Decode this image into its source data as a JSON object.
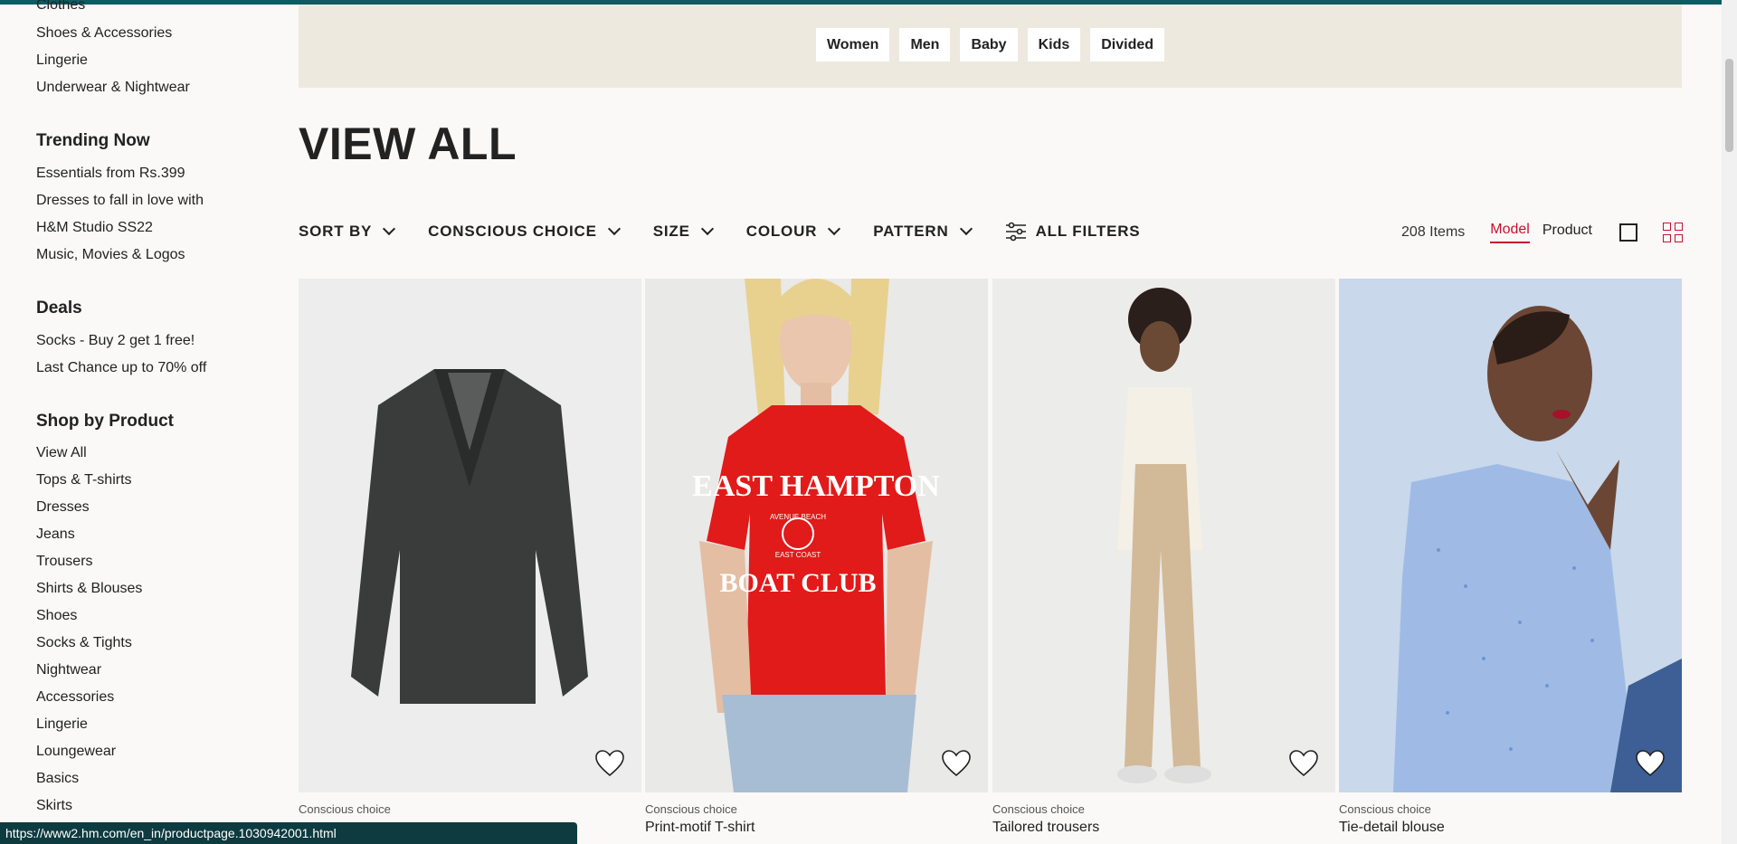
{
  "sidebar": {
    "top_links": [
      "Clothes",
      "Shoes & Accessories",
      "Lingerie",
      "Underwear & Nightwear"
    ],
    "trending_heading": "Trending Now",
    "trending": [
      "Essentials from Rs.399",
      "Dresses to fall in love with",
      "H&M Studio SS22",
      "Music, Movies & Logos"
    ],
    "deals_heading": "Deals",
    "deals": [
      "Socks - Buy 2 get 1 free!",
      "Last Chance up to 70% off"
    ],
    "product_heading": "Shop by Product",
    "products": [
      "View All",
      "Tops & T-shirts",
      "Dresses",
      "Jeans",
      "Trousers",
      "Shirts & Blouses",
      "Shoes",
      "Socks & Tights",
      "Nightwear",
      "Accessories",
      "Lingerie",
      "Loungewear",
      "Basics",
      "Skirts"
    ]
  },
  "banner": {
    "pills": [
      "Women",
      "Men",
      "Baby",
      "Kids",
      "Divided"
    ]
  },
  "page_title": "VIEW ALL",
  "filters": {
    "sort_by": "SORT BY",
    "conscious": "CONSCIOUS CHOICE",
    "size": "SIZE",
    "colour": "COLOUR",
    "pattern": "PATTERN",
    "all_filters": "ALL FILTERS"
  },
  "toolbar": {
    "count": "208 Items",
    "model": "Model",
    "product": "Product"
  },
  "products": [
    {
      "tag": "Conscious choice",
      "title": ""
    },
    {
      "tag": "Conscious choice",
      "title": "Print-motif T-shirt"
    },
    {
      "tag": "Conscious choice",
      "title": "Tailored trousers"
    },
    {
      "tag": "Conscious choice",
      "title": "Tie-detail blouse"
    }
  ],
  "print_text": {
    "line1": "EAST HAMPTON",
    "line2": "AVENUE BEACH",
    "line3": "EAST COAST",
    "line4": "BOAT CLUB"
  },
  "status_url": "https://www2.hm.com/en_in/productpage.1030942001.html",
  "colors": {
    "accent": "#c8102e",
    "banner_bg": "#eee9df",
    "page_bg": "#faf9f8",
    "top_border": "#0d5c63"
  }
}
